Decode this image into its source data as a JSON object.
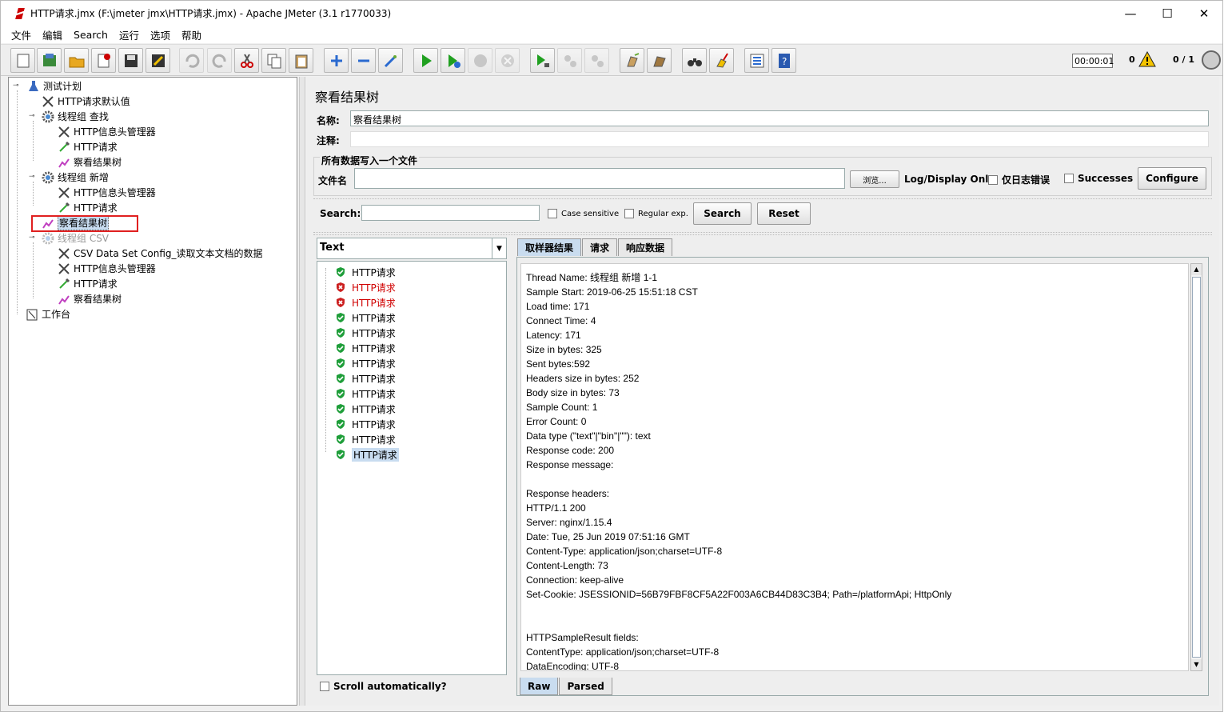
{
  "window": {
    "title": "HTTP请求.jmx (F:\\jmeter jmx\\HTTP请求.jmx) - Apache JMeter (3.1 r1770033)",
    "minimize": "—",
    "maximize": "☐",
    "close": "✕"
  },
  "menu": [
    "文件",
    "编辑",
    "Search",
    "运行",
    "选项",
    "帮助"
  ],
  "status": {
    "timer": "00:00:01",
    "warnings": "0",
    "threads": "0 / 1"
  },
  "tree": [
    {
      "label": "测试计划",
      "icon": "flask-icon",
      "handle": "⊸"
    },
    {
      "label": "HTTP请求默认值",
      "icon": "wrench-icon"
    },
    {
      "label": "线程组 查找",
      "icon": "gear-icon",
      "handle": "⊸"
    },
    {
      "label": "HTTP信息头管理器",
      "icon": "wrench-icon"
    },
    {
      "label": "HTTP请求",
      "icon": "pipette-icon"
    },
    {
      "label": "察看结果树",
      "icon": "chart-icon"
    },
    {
      "label": "线程组 新增",
      "icon": "gear-icon",
      "handle": "⊸"
    },
    {
      "label": "HTTP信息头管理器",
      "icon": "wrench-icon"
    },
    {
      "label": "HTTP请求",
      "icon": "pipette-icon"
    },
    {
      "label": "察看结果树",
      "icon": "chart-icon"
    },
    {
      "label": "线程组  CSV",
      "icon": "gear-icon",
      "handle": "⊸"
    },
    {
      "label": "CSV Data Set Config_读取文本文档的数据",
      "icon": "wrench-icon"
    },
    {
      "label": "HTTP信息头管理器",
      "icon": "wrench-icon"
    },
    {
      "label": "HTTP请求",
      "icon": "pipette-icon"
    },
    {
      "label": "察看结果树",
      "icon": "chart-icon"
    },
    {
      "label": "工作台",
      "icon": "clipboard-icon"
    }
  ],
  "panel": {
    "title": "察看结果树",
    "name_label": "名称:",
    "name_value": "察看结果树",
    "comment_label": "注释:",
    "group_title": "所有数据写入一个文件",
    "file_label": "文件名",
    "browse": "浏览...",
    "log_display": "Log/Display Only:",
    "errors_only": "仅日志错误",
    "successes": "Successes",
    "configure": "Configure",
    "search_label": "Search:",
    "case_sensitive": "Case sensitive",
    "regular_exp": "Regular exp.",
    "search_btn": "Search",
    "reset_btn": "Reset"
  },
  "results": {
    "renderer": "Text",
    "scroll_auto": "Scroll automatically?",
    "items": [
      {
        "label": "HTTP请求",
        "status": "ok"
      },
      {
        "label": "HTTP请求",
        "status": "error"
      },
      {
        "label": "HTTP请求",
        "status": "error"
      },
      {
        "label": "HTTP请求",
        "status": "ok"
      },
      {
        "label": "HTTP请求",
        "status": "ok"
      },
      {
        "label": "HTTP请求",
        "status": "ok"
      },
      {
        "label": "HTTP请求",
        "status": "ok"
      },
      {
        "label": "HTTP请求",
        "status": "ok"
      },
      {
        "label": "HTTP请求",
        "status": "ok"
      },
      {
        "label": "HTTP请求",
        "status": "ok"
      },
      {
        "label": "HTTP请求",
        "status": "ok"
      },
      {
        "label": "HTTP请求",
        "status": "ok"
      },
      {
        "label": "HTTP请求",
        "status": "ok"
      }
    ]
  },
  "tabs": [
    "取样器结果",
    "请求",
    "响应数据"
  ],
  "bottom_tabs": [
    "Raw",
    "Parsed"
  ],
  "detail_lines": [
    "Thread Name: 线程组 新增 1-1",
    "Sample Start: 2019-06-25 15:51:18 CST",
    "Load time: 171",
    "Connect Time: 4",
    "Latency: 171",
    "Size in bytes: 325",
    "Sent bytes:592",
    "Headers size in bytes: 252",
    "Body size in bytes: 73",
    "Sample Count: 1",
    "Error Count: 0",
    "Data type (\"text\"|\"bin\"|\"\"): text",
    "Response code: 200",
    "Response message: ",
    "",
    "Response headers:",
    "HTTP/1.1 200",
    "Server: nginx/1.15.4",
    "Date: Tue, 25 Jun 2019 07:51:16 GMT",
    "Content-Type: application/json;charset=UTF-8",
    "Content-Length: 73",
    "Connection: keep-alive",
    "Set-Cookie: JSESSIONID=56B79FBF8CF5A22F003A6CB44D83C3B4; Path=/platformApi; HttpOnly",
    "",
    "",
    "HTTPSampleResult fields:",
    "ContentType: application/json;charset=UTF-8",
    "DataEncoding: UTF-8"
  ],
  "colors": {
    "error_text": "#d00000",
    "selection": "#c8dcf0",
    "highlight_box": "#e02020"
  }
}
